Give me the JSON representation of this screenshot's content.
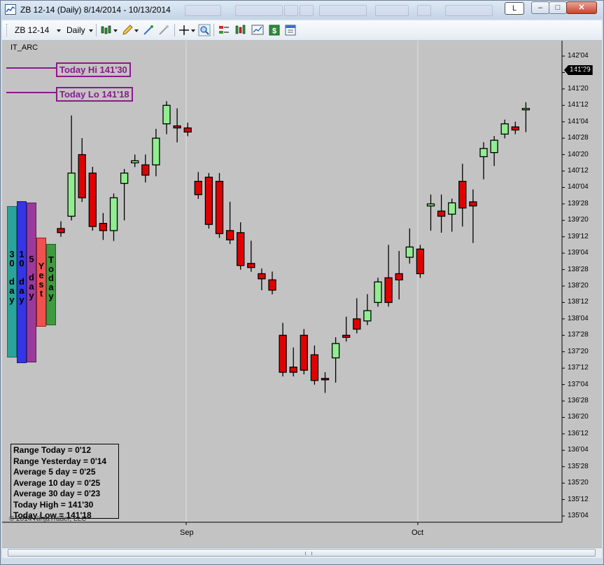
{
  "window": {
    "title": "ZB 12-14 (Daily)  8/14/2014 - 10/13/2014",
    "link_button_label": "L",
    "minimize_symbol": "‒",
    "maximize_symbol": "□",
    "close_symbol": "✕"
  },
  "toolbar": {
    "instrument": "ZB 12-14",
    "interval": "Daily"
  },
  "chart": {
    "indicator_name": "IT_ARC",
    "today_hi_label": "Today Hi 141'30",
    "today_lo_label": "Today Lo 141'18",
    "last_price": "141'29",
    "volume_profile_labels": {
      "d30": "30 day",
      "d10": "10 day",
      "d5": "5 day",
      "yest": "Yest",
      "today": "Today"
    },
    "stats": [
      "Range Today = 0'12",
      "Range Yesterday = 0'14",
      "Average 5 day = 0'25",
      "Average 10 day = 0'25",
      "Average 30 day = 0'23",
      "Today High = 141'30",
      "Today Low = 141'18"
    ],
    "copyright": "© 2014 NinjaTrader, LLC",
    "colors": {
      "up": "#90ee90",
      "down": "#e00000",
      "background": "#c3c3c3",
      "hilo": "#8b1a8b"
    }
  },
  "chart_data": {
    "type": "candlestick",
    "title": "ZB 12-14 (Daily)",
    "y_axis_ticks": [
      "142'04",
      "141'28",
      "141'20",
      "141'12",
      "141'04",
      "140'28",
      "140'20",
      "140'12",
      "140'04",
      "139'28",
      "139'20",
      "139'12",
      "139'04",
      "138'28",
      "138'20",
      "138'12",
      "138'04",
      "137'28",
      "137'20",
      "137'12",
      "137'04",
      "136'28",
      "136'20",
      "136'12",
      "136'04",
      "135'28",
      "135'20",
      "135'12",
      "135'04"
    ],
    "x_axis_ticks": [
      "Sep",
      "Oct"
    ],
    "candles_note": "Values in 32nds offsets from 135'04, order left to right",
    "candles": [
      {
        "o": 140.0,
        "h": 141.5,
        "l": 139.0,
        "c": 138.0
      },
      {
        "o": 146.0,
        "h": 193.0,
        "l": 157.5,
        "c": 167.0
      },
      {
        "o": 176.0,
        "h": 182.0,
        "l": 155.0,
        "c": 155.0
      },
      {
        "o": 167.0,
        "h": 168.0,
        "l": 141.5,
        "c": 141.0
      },
      {
        "o": 142.5,
        "h": 145.5,
        "l": 136.5,
        "c": 139.0
      },
      {
        "o": 139.0,
        "h": 154.5,
        "l": 136.0,
        "c": 155.0
      },
      {
        "o": 162.0,
        "h": 165.0,
        "l": 146.0,
        "c": 167.0
      },
      {
        "o": 172.0,
        "h": 174.0,
        "l": 172.5,
        "c": 173.0
      },
      {
        "o": 171.0,
        "h": 174.0,
        "l": 164.5,
        "c": 166.0
      },
      {
        "o": 171.0,
        "h": 186.5,
        "l": 167.5,
        "c": 184.0
      },
      {
        "o": 191.0,
        "h": 198.0,
        "l": 188.0,
        "c": 200.0
      },
      {
        "o": 190.0,
        "h": 196.5,
        "l": 184.0,
        "c": 189.0
      },
      {
        "o": 189.0,
        "h": 189.5,
        "l": 187.5,
        "c": 187.0
      },
      {
        "o": 163.0,
        "h": 165.5,
        "l": 157.5,
        "c": 156.5
      },
      {
        "o": 165.0,
        "h": 165.0,
        "l": 148.0,
        "c": 142.0
      },
      {
        "o": 163.0,
        "h": 165.0,
        "l": 137.5,
        "c": 137.5
      },
      {
        "o": 139.0,
        "h": 151.0,
        "l": 134.5,
        "c": 134.5
      },
      {
        "o": 138.0,
        "h": 141.0,
        "l": 127.0,
        "c": 122.0
      },
      {
        "o": 123.0,
        "h": 132.0,
        "l": 121.0,
        "c": 121.0
      },
      {
        "o": 118.0,
        "h": 118.5,
        "l": 112.0,
        "c": 115.5
      },
      {
        "o": 115.0,
        "h": 117.0,
        "l": 113.0,
        "c": 110.0
      },
      {
        "o": 88.0,
        "h": 92.0,
        "l": 70.0,
        "c": 70.0
      },
      {
        "o": 72.5,
        "h": 80.0,
        "l": 74.0,
        "c": 70.0
      },
      {
        "o": 88.0,
        "h": 89.0,
        "l": 73.0,
        "c": 71.0
      },
      {
        "o": 78.5,
        "h": 81.0,
        "l": 68.0,
        "c": 66.0
      },
      {
        "o": 67.0,
        "h": 68.0,
        "l": 62.0,
        "c": 66.5
      },
      {
        "o": 77.0,
        "h": 85.0,
        "l": 67.0,
        "c": 84.0
      },
      {
        "o": 88.0,
        "h": 95.0,
        "l": 93.5,
        "c": 87.0
      },
      {
        "o": 96.0,
        "h": 104.0,
        "l": 97.0,
        "c": 91.0
      },
      {
        "o": 95.0,
        "h": 106.0,
        "l": 95.0,
        "c": 100.0
      },
      {
        "o": 104.0,
        "h": 114.0,
        "l": 110.0,
        "c": 114.0
      },
      {
        "o": 116.0,
        "h": 130.0,
        "l": 119.0,
        "c": 104.0
      },
      {
        "o": 118.0,
        "h": 127.0,
        "l": 107.5,
        "c": 115.0
      },
      {
        "o": 126.0,
        "h": 138.0,
        "l": 125.0,
        "c": 131.0
      },
      {
        "o": 130.0,
        "h": 125.0,
        "l": 126.5,
        "c": 118.0
      },
      {
        "o": 151.0,
        "h": 154.5,
        "l": 141.0,
        "c": 152.0
      },
      {
        "o": 148.5,
        "h": 154.5,
        "l": 140.0,
        "c": 146.0
      },
      {
        "o": 147.0,
        "h": 152.5,
        "l": 140.5,
        "c": 152.5
      },
      {
        "o": 163.0,
        "h": 169.5,
        "l": 143.0,
        "c": 150.0
      },
      {
        "o": 153.0,
        "h": 157.0,
        "l": 135.0,
        "c": 151.0
      },
      {
        "o": 175.0,
        "h": 180.0,
        "l": 166.0,
        "c": 179.0
      },
      {
        "o": 177.0,
        "h": 183.0,
        "l": 172.5,
        "c": 183.0
      },
      {
        "o": 186.0,
        "h": 188.0,
        "l": 187.0,
        "c": 191.0
      },
      {
        "o": 189.5,
        "h": 190.0,
        "l": 189.0,
        "c": 188.0
      },
      {
        "o": 198.0,
        "h": 199.5,
        "l": 189.0,
        "c": 198.5
      }
    ]
  }
}
